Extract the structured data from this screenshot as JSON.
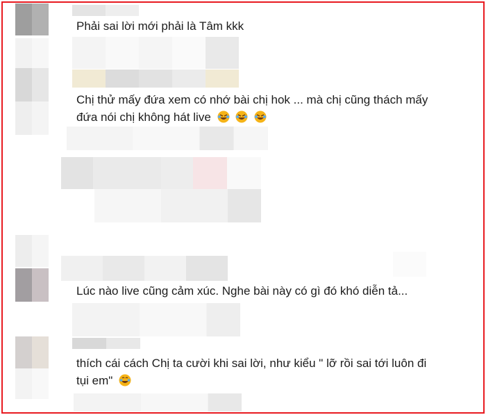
{
  "colors": {
    "frame_border": "#e8191f",
    "text": "#1c1c1c"
  },
  "comments": [
    {
      "text": "Phải sai lời mới phải là Tâm kkk",
      "emoji": []
    },
    {
      "text_line1": "Chị thử mấy đứa xem có nhớ bài chị hok ... mà chị cũng thách mấy",
      "text_line2": "đứa nói chị không hát live",
      "emoji": [
        "rofl-emoji",
        "rofl-emoji",
        "rofl-emoji"
      ]
    },
    {
      "text": "Lúc nào live cũng cảm xúc. Nghe bài này có gì đó khó diễn tả...",
      "emoji": []
    },
    {
      "text_line1": "thích cái cách Chị ta cười khi sai lời, như kiểu \" lỡ rồi sai tới luôn đi",
      "text_line2": "tụi em\"",
      "emoji": [
        "laughing-tears-emoji"
      ]
    }
  ]
}
